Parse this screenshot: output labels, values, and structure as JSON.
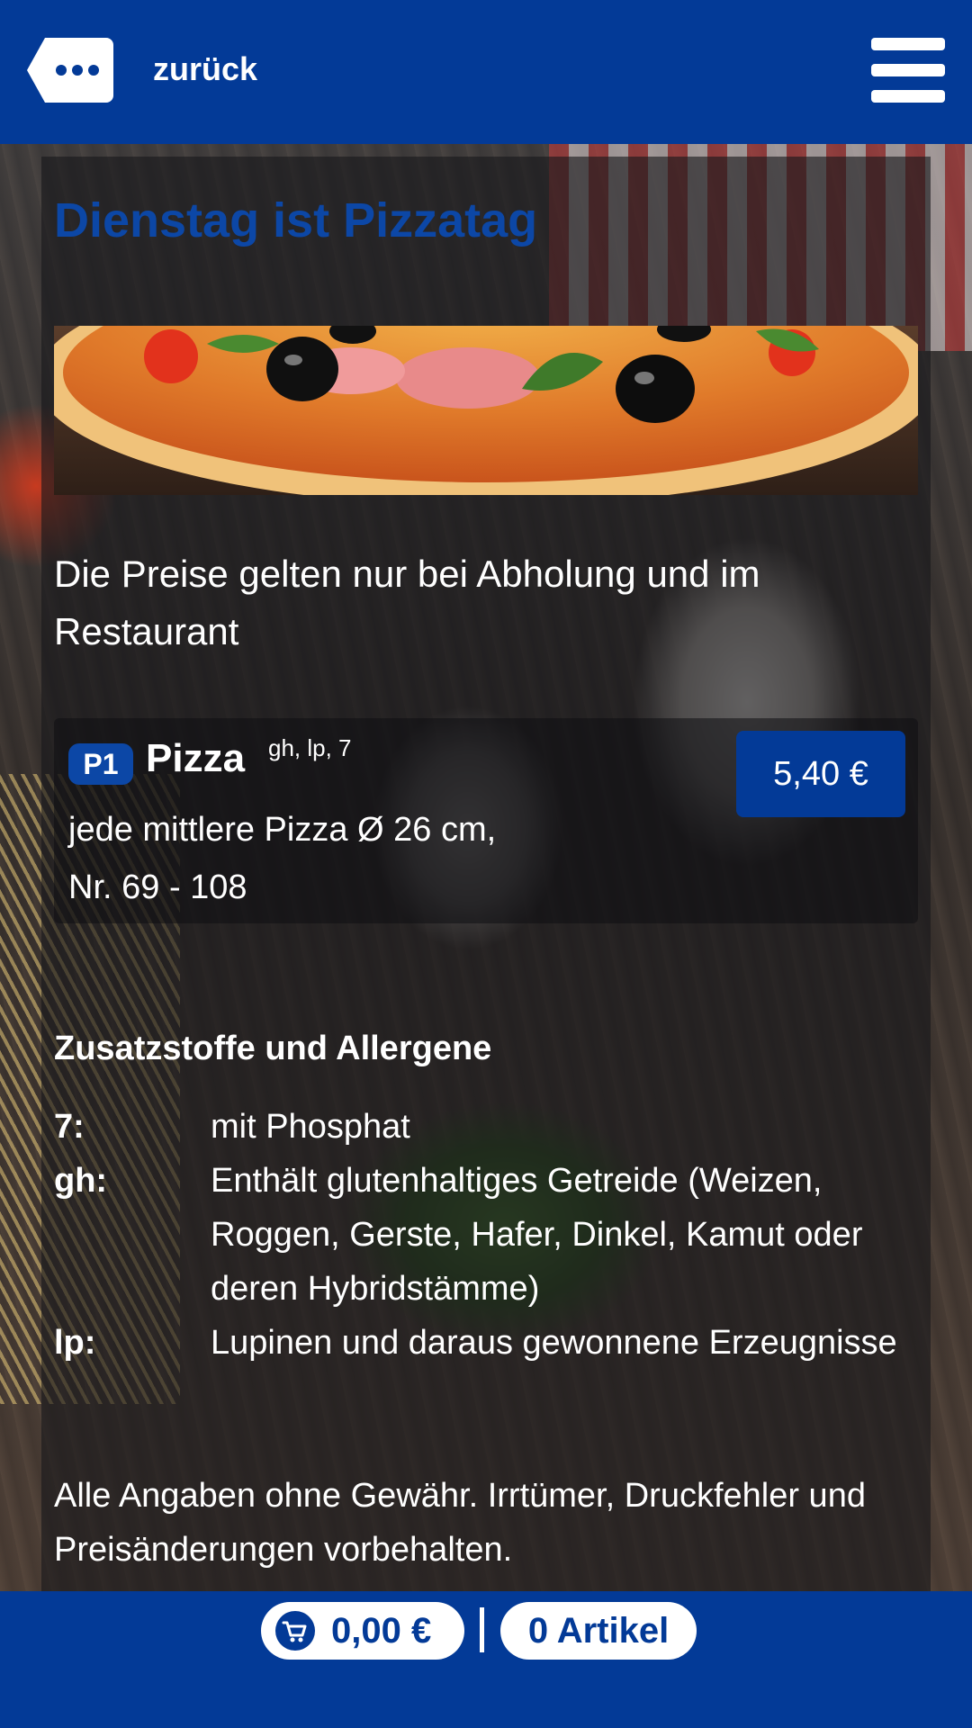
{
  "header": {
    "back_label": "zurück"
  },
  "content": {
    "title": "Dienstag ist Pizzatag",
    "intro": "Die Preise gelten nur bei Abholung und im Restaurant",
    "product": {
      "code": "P1",
      "name": "Pizza",
      "allergen_refs": "gh, lp, 7",
      "description_line1": "jede mittlere Pizza Ø 26 cm,",
      "description_line2": "Nr. 69 - 108",
      "price": "5,40 €"
    },
    "additives_title": "Zusatzstoffe und Allergene",
    "additives": [
      {
        "key": "7:",
        "value": "mit Phosphat"
      },
      {
        "key": "gh:",
        "value": "Enthält glutenhaltiges Getreide (Weizen, Roggen, Gerste, Hafer, Dinkel, Kamut oder deren Hybridstämme)"
      },
      {
        "key": "lp:",
        "value": "Lupinen und daraus gewonnene Erzeugnisse"
      }
    ],
    "disclaimer": "Alle Angaben ohne Gewähr. Irrtümer, Druckfehler und Preisänderungen vorbehalten."
  },
  "cart": {
    "total": "0,00 €",
    "count": "0 Artikel"
  },
  "colors": {
    "brand_blue": "#033a97",
    "title_blue": "#0c47a6"
  }
}
